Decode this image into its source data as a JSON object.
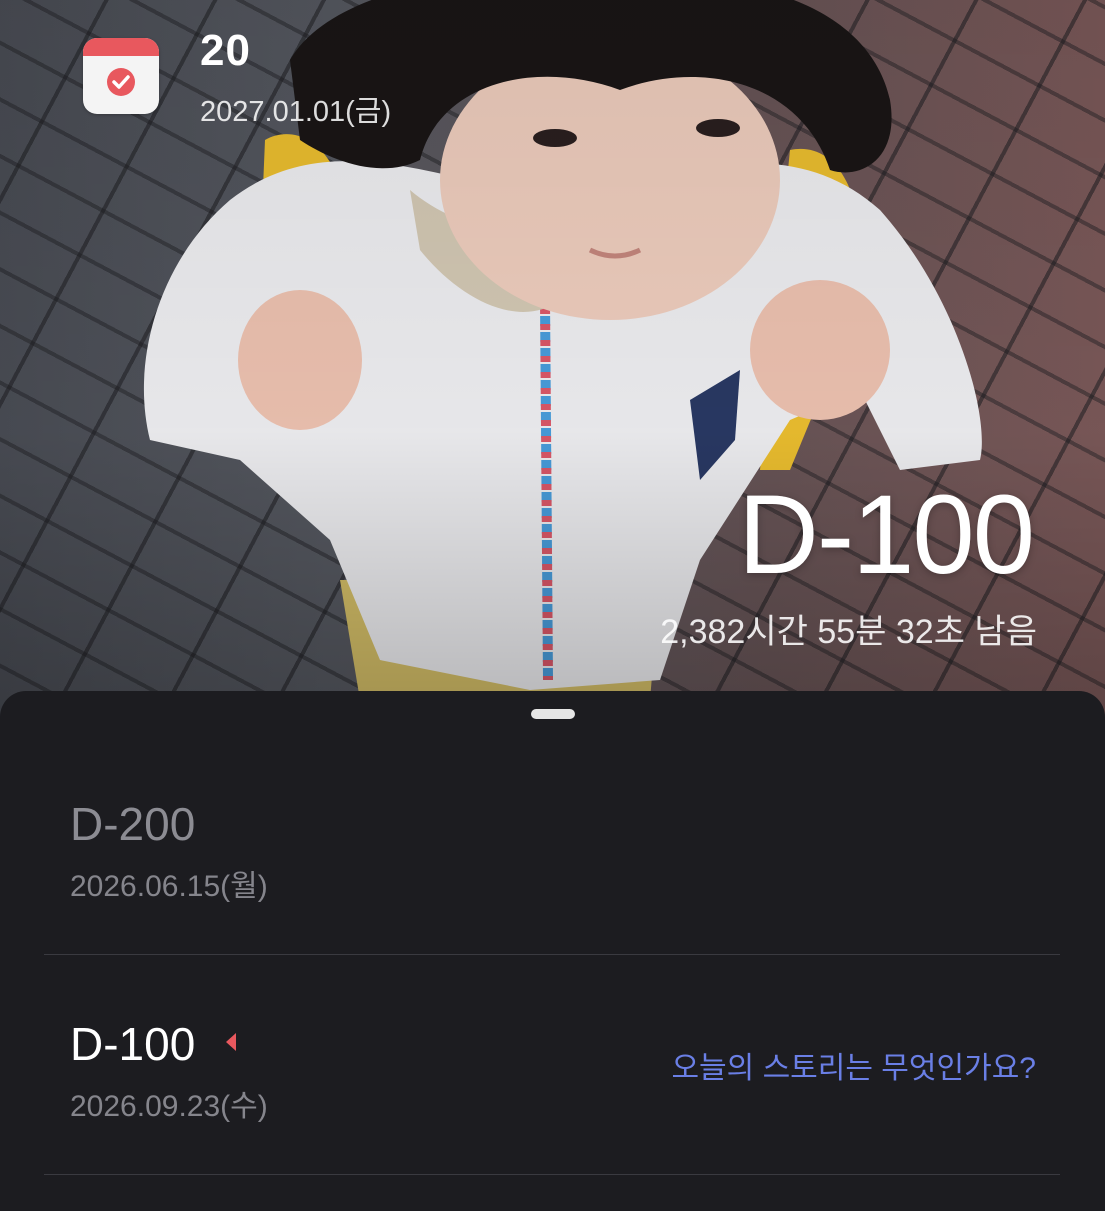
{
  "header": {
    "title": "20",
    "date": "2027.01.01(금)",
    "icon": "calendar-check-icon"
  },
  "countdown": {
    "label": "D-100",
    "remaining": "2,382시간 55분 32초 남음"
  },
  "list": {
    "items": [
      {
        "title": "D-200",
        "date": "2026.06.15(월)"
      },
      {
        "title": "D-100",
        "date": "2026.09.23(수)",
        "marker": "caret-left-icon",
        "story_prompt": "오늘의 스토리는 무엇인가요?"
      }
    ]
  },
  "colors": {
    "accent_red": "#e8585e",
    "link_blue": "#6a7fe6",
    "sheet_bg": "#1c1c20"
  }
}
